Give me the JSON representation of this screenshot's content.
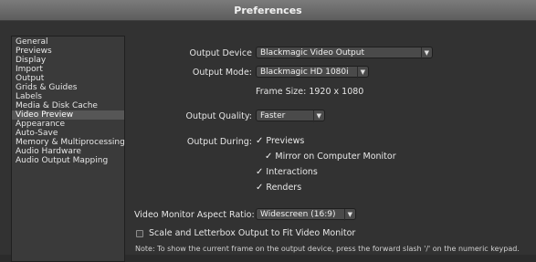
{
  "window": {
    "title": "Preferences"
  },
  "sidebar": {
    "items": [
      {
        "label": "General"
      },
      {
        "label": "Previews"
      },
      {
        "label": "Display"
      },
      {
        "label": "Import"
      },
      {
        "label": "Output"
      },
      {
        "label": "Grids & Guides"
      },
      {
        "label": "Labels"
      },
      {
        "label": "Media & Disk Cache"
      },
      {
        "label": "Video Preview",
        "selected": true
      },
      {
        "label": "Appearance"
      },
      {
        "label": "Auto-Save"
      },
      {
        "label": "Memory & Multiprocessing"
      },
      {
        "label": "Audio Hardware"
      },
      {
        "label": "Audio Output Mapping"
      }
    ]
  },
  "video_preview": {
    "output_device": {
      "label": "Output Device",
      "value": "Blackmagic Video Output"
    },
    "output_mode": {
      "label": "Output Mode:",
      "value": "Blackmagic HD 1080i"
    },
    "frame_size": "Frame Size:  1920 x 1080",
    "output_quality": {
      "label": "Output Quality:",
      "value": "Faster"
    },
    "output_during": {
      "label": "Output During:",
      "previews": {
        "label": "Previews",
        "checked": true
      },
      "mirror": {
        "label": "Mirror on Computer Monitor",
        "checked": true
      },
      "interactions": {
        "label": "Interactions",
        "checked": true
      },
      "renders": {
        "label": "Renders",
        "checked": true
      }
    },
    "aspect_ratio": {
      "label": "Video Monitor Aspect Ratio:",
      "value": "Widescreen (16:9)"
    },
    "scale_letterbox": {
      "label": "Scale and Letterbox Output to Fit Video Monitor",
      "checked": false
    },
    "note": "Note: To show the current frame on the output device, press the forward slash '/' on the numeric keypad."
  }
}
